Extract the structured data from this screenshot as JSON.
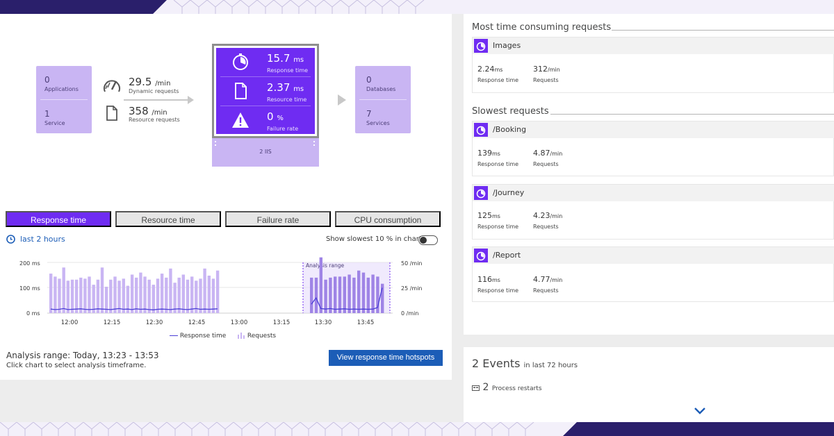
{
  "flow": {
    "apps": {
      "count": "0",
      "label": "Applications"
    },
    "service": {
      "count": "1",
      "label": "Service"
    },
    "dynamic": {
      "value": "29.5",
      "unit": "/min",
      "label": "Dynamic requests"
    },
    "resource": {
      "value": "358",
      "unit": "/min",
      "label": "Resource requests"
    },
    "response_time": {
      "value": "15.7",
      "unit": "ms",
      "label": "Response time"
    },
    "resource_time": {
      "value": "2.37",
      "unit": "ms",
      "label": "Resource time"
    },
    "failure_rate": {
      "value": "0",
      "unit": "%",
      "label": "Failure rate"
    },
    "host_label": "2 IIS",
    "databases": {
      "count": "0",
      "label": "Databases"
    },
    "services": {
      "count": "7",
      "label": "Services"
    }
  },
  "tabs": [
    {
      "label": "Response time",
      "active": true
    },
    {
      "label": "Resource time",
      "active": false
    },
    {
      "label": "Failure rate",
      "active": false
    },
    {
      "label": "CPU consumption",
      "active": false
    }
  ],
  "timeframe": "last 2 hours",
  "toggle_label": "Show slowest 10 % in chart",
  "chart_data": {
    "type": "bar",
    "x_ticks": [
      "12:00",
      "12:15",
      "12:30",
      "12:45",
      "13:00",
      "13:15",
      "13:30",
      "13:45"
    ],
    "y_left_ticks": [
      "200 ms",
      "100 ms",
      "0 ms"
    ],
    "y_right_ticks": [
      "50 /min",
      "25 /min",
      "0 /min"
    ],
    "analysis_label": "Analysis range",
    "series": [
      {
        "name": "Requests",
        "unit": "/min",
        "values": [
          39,
          36,
          34,
          45,
          32,
          33,
          33,
          35,
          34,
          36,
          28,
          33,
          45,
          26,
          33,
          36,
          32,
          34,
          27,
          38,
          35,
          40,
          36,
          33,
          28,
          34,
          39,
          35,
          44,
          30,
          35,
          38,
          33,
          36,
          32,
          34,
          44,
          37,
          34,
          42,
          35,
          35,
          55,
          33,
          35,
          36,
          36,
          36,
          38,
          35,
          42,
          40,
          35,
          38,
          36,
          29
        ]
      },
      {
        "name": "Response time",
        "unit": "ms",
        "values": [
          16,
          14,
          15,
          18,
          14,
          15,
          16,
          17,
          15,
          14,
          15,
          17,
          16,
          15,
          14,
          16,
          18,
          15,
          16,
          14,
          17,
          15,
          16,
          14,
          13,
          15,
          16,
          15,
          14,
          16,
          17,
          15,
          14,
          16,
          18,
          15,
          16,
          15,
          16,
          17,
          35,
          60,
          18,
          16,
          18,
          15,
          16,
          17,
          15,
          16,
          15,
          16,
          15,
          16,
          22,
          100
        ]
      }
    ],
    "left_range": [
      0,
      200
    ],
    "right_range": [
      0,
      50
    ],
    "legend": [
      "Response time",
      "Requests"
    ]
  },
  "analysis": {
    "range_text": "Analysis range: Today, 13:23 - 13:53",
    "hint": "Click chart to select analysis timeframe.",
    "button": "View response time hotspots"
  },
  "time_consuming": {
    "title": "Most time consuming requests",
    "items": [
      {
        "name": "Images",
        "time": "2.24",
        "time_unit": "ms",
        "req": "312",
        "req_unit": "/min",
        "time_label": "Response time",
        "req_label": "Requests"
      }
    ]
  },
  "slowest": {
    "title": "Slowest requests",
    "items": [
      {
        "name": "/Booking",
        "time": "139",
        "time_unit": "ms",
        "req": "4.87",
        "req_unit": "/min",
        "time_label": "Response time",
        "req_label": "Requests"
      },
      {
        "name": "/Journey",
        "time": "125",
        "time_unit": "ms",
        "req": "4.23",
        "req_unit": "/min",
        "time_label": "Response time",
        "req_label": "Requests"
      },
      {
        "name": "/Report",
        "time": "116",
        "time_unit": "ms",
        "req": "4.77",
        "req_unit": "/min",
        "time_label": "Response time",
        "req_label": "Requests"
      }
    ]
  },
  "events": {
    "count": "2 Events",
    "period": "in last 72 hours",
    "restarts_count": "2",
    "restarts_label": "Process restarts"
  },
  "colors": {
    "accent": "#6f2cf2",
    "accent_light": "#c9b5f3",
    "link": "#1c5db7",
    "dark_band": "#2a1f6b"
  }
}
